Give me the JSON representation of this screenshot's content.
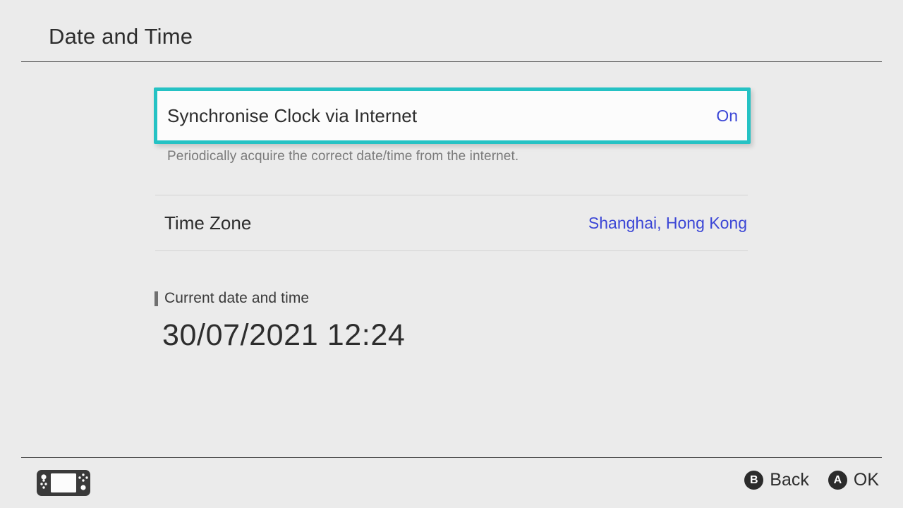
{
  "header": {
    "title": "Date and Time"
  },
  "settings": {
    "sync_clock": {
      "label": "Synchronise Clock via Internet",
      "value": "On",
      "description": "Periodically acquire the correct date/time from the internet.",
      "selected": true
    },
    "time_zone": {
      "label": "Time Zone",
      "value": "Shanghai, Hong Kong"
    }
  },
  "current_datetime": {
    "heading": "Current date and time",
    "value": "30/07/2021 12:24"
  },
  "footer": {
    "console_icon": "switch-console-icon",
    "actions": [
      {
        "button": "B",
        "label": "Back",
        "icon": "b-button-icon"
      },
      {
        "button": "A",
        "label": "OK",
        "icon": "a-button-icon"
      }
    ]
  },
  "colors": {
    "background": "#ebebeb",
    "highlight": "#25c2c4",
    "link": "#3b46d6",
    "text": "#2d2d2d",
    "muted": "#7a7a7a"
  }
}
